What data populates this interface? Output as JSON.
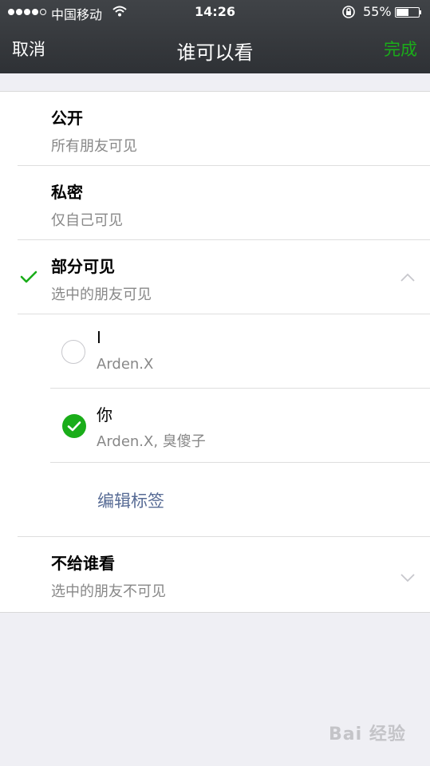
{
  "status_bar": {
    "carrier": "中国移动",
    "time": "14:26",
    "battery_percent": "55%",
    "battery_level": 0.55,
    "signal_bars": 5,
    "signal_filled": 4
  },
  "nav": {
    "cancel_label": "取消",
    "title": "谁可以看",
    "done_label": "完成",
    "done_color": "#1aad19"
  },
  "options": [
    {
      "title": "公开",
      "subtitle": "所有朋友可见",
      "selected": false
    },
    {
      "title": "私密",
      "subtitle": "仅自己可见",
      "selected": false
    },
    {
      "title": "部分可见",
      "subtitle": "选中的朋友可见",
      "selected": true,
      "expanded": true,
      "chevron": "chevron-up-icon"
    },
    {
      "title": "不给谁看",
      "subtitle": "选中的朋友不可见",
      "selected": false,
      "expanded": false,
      "chevron": "chevron-down-icon"
    }
  ],
  "tags": [
    {
      "name": "I",
      "members": "Arden.X",
      "checked": false
    },
    {
      "name": "你",
      "members": "Arden.X, 臭傻子",
      "checked": true
    }
  ],
  "edit_tags_label": "编辑标签",
  "watermark": "Bai 经验",
  "colors": {
    "accent_green": "#1aad19",
    "link_blue": "#576b95",
    "nav_bg": "#2e3135",
    "page_bg": "#efeff4"
  }
}
